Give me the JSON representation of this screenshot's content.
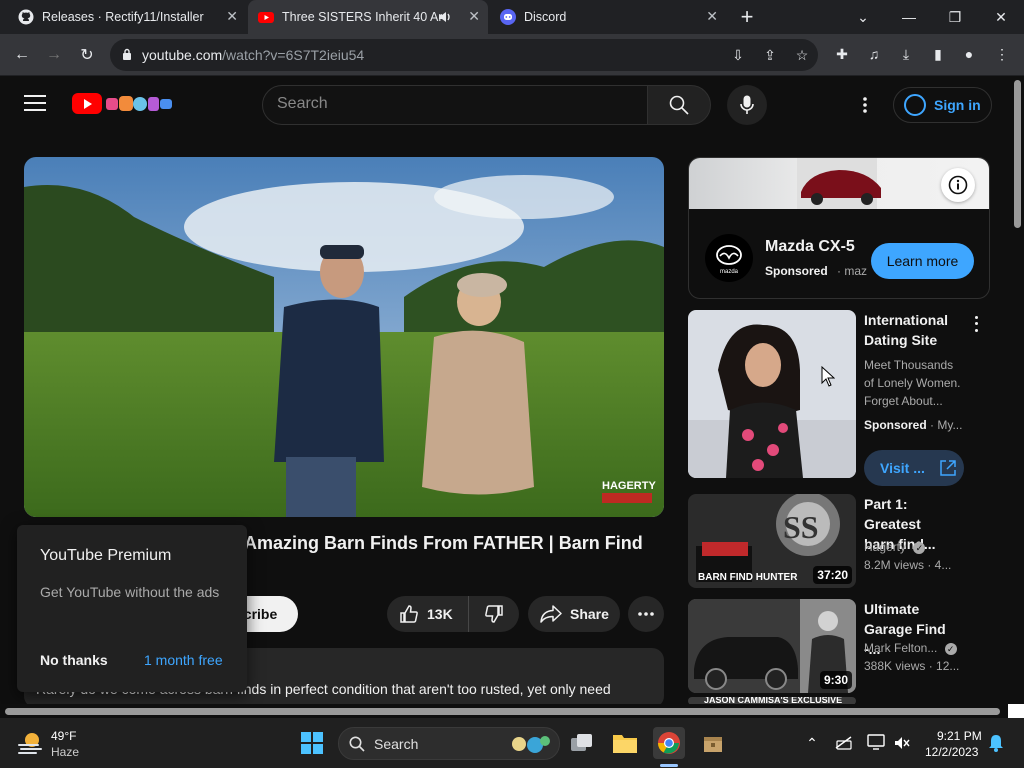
{
  "browser": {
    "tabs": [
      {
        "title": "Releases · Rectify11/Installer",
        "active": false
      },
      {
        "title": "Three SISTERS Inherit 40 Am",
        "active": true
      },
      {
        "title": "Discord",
        "active": false
      }
    ],
    "url_host": "youtube.com",
    "url_path": "/watch?v=6S7T2ieiu54"
  },
  "header": {
    "search_placeholder": "Search",
    "signin_label": "Sign in"
  },
  "video": {
    "title": "Amazing Barn Finds From FATHER | Barn Find",
    "subscribe_label": "scribe",
    "like_count": "13K",
    "share_label": "Share",
    "watermark": "HAGERTY",
    "description": "Rarely do we come across barn finds in perfect condition that aren't too rusted, yet only need"
  },
  "premium_popup": {
    "title": "YouTube Premium",
    "subtitle": "Get YouTube without the ads",
    "dismiss_label": "No thanks",
    "cta_label": "1 month free"
  },
  "sidebar": {
    "ad": {
      "title": "Mazda CX-5",
      "sponsored": "Sponsored",
      "domain": "· maz",
      "cta": "Learn more",
      "logo_text": "mazda"
    },
    "items": [
      {
        "title_line1": "International",
        "title_line2": "Dating Site",
        "meta1": "Meet Thousands",
        "meta2": "of Lonely Women.",
        "meta3": "Forget About...",
        "sponsored": "Sponsored",
        "sponsored_domain": "· My...",
        "cta": "Visit ..."
      },
      {
        "title_line1": "Part 1: Greatest",
        "title_line2": "barn find...",
        "channel": "Hagerty",
        "stats": "8.2M views · 4...",
        "duration": "37:20",
        "thumb_text": "BARN FIND HUNTER"
      },
      {
        "title_line1": "Ultimate",
        "title_line2": "Garage Find -...",
        "channel": "Mark Felton...",
        "stats": "388K views · 12...",
        "duration": "9:30"
      },
      {
        "thumb_text": "JASON CAMMISA'S EXCLUSIVE"
      }
    ]
  },
  "taskbar": {
    "weather_temp": "49°F",
    "weather_desc": "Haze",
    "search_label": "Search",
    "time": "9:21 PM",
    "date": "12/2/2023"
  }
}
